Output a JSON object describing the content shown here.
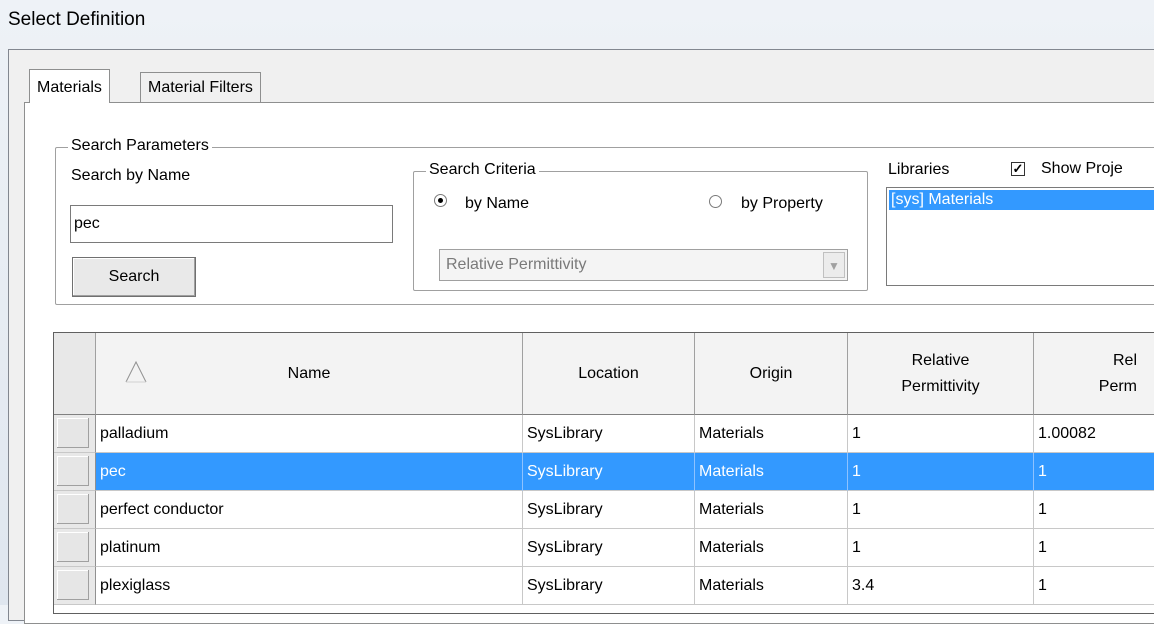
{
  "window": {
    "title": "Select Definition"
  },
  "tabs": [
    {
      "label": "Materials",
      "active": true
    },
    {
      "label": "Material Filters",
      "active": false
    }
  ],
  "search_parameters": {
    "legend": "Search Parameters",
    "name_label": "Search by Name",
    "name_value": "pec",
    "search_button": "Search"
  },
  "search_criteria": {
    "legend": "Search Criteria",
    "by_name_label": "by Name",
    "by_property_label": "by Property",
    "selected": "by Name",
    "property_select_value": "Relative Permittivity"
  },
  "libraries": {
    "label": "Libraries",
    "show_project_label": "Show Proje",
    "show_project_checked": true,
    "items": [
      "[sys] Materials"
    ]
  },
  "table": {
    "columns": [
      "Name",
      "Location",
      "Origin",
      "Relative\nPermittivity",
      "Rel\nPerm"
    ],
    "sort_indicator": "ascending",
    "rows": [
      {
        "name": "palladium",
        "location": "SysLibrary",
        "origin": "Materials",
        "rel_permittivity": "1",
        "rel_permeability": "1.00082",
        "selected": false
      },
      {
        "name": "pec",
        "location": "SysLibrary",
        "origin": "Materials",
        "rel_permittivity": "1",
        "rel_permeability": "1",
        "selected": true
      },
      {
        "name": "perfect conductor",
        "location": "SysLibrary",
        "origin": "Materials",
        "rel_permittivity": "1",
        "rel_permeability": "1",
        "selected": false
      },
      {
        "name": "platinum",
        "location": "SysLibrary",
        "origin": "Materials",
        "rel_permittivity": "1",
        "rel_permeability": "1",
        "selected": false
      },
      {
        "name": "plexiglass",
        "location": "SysLibrary",
        "origin": "Materials",
        "rel_permittivity": "3.4",
        "rel_permeability": "1",
        "selected": false
      }
    ]
  },
  "colors": {
    "selection": "#3399ff"
  }
}
